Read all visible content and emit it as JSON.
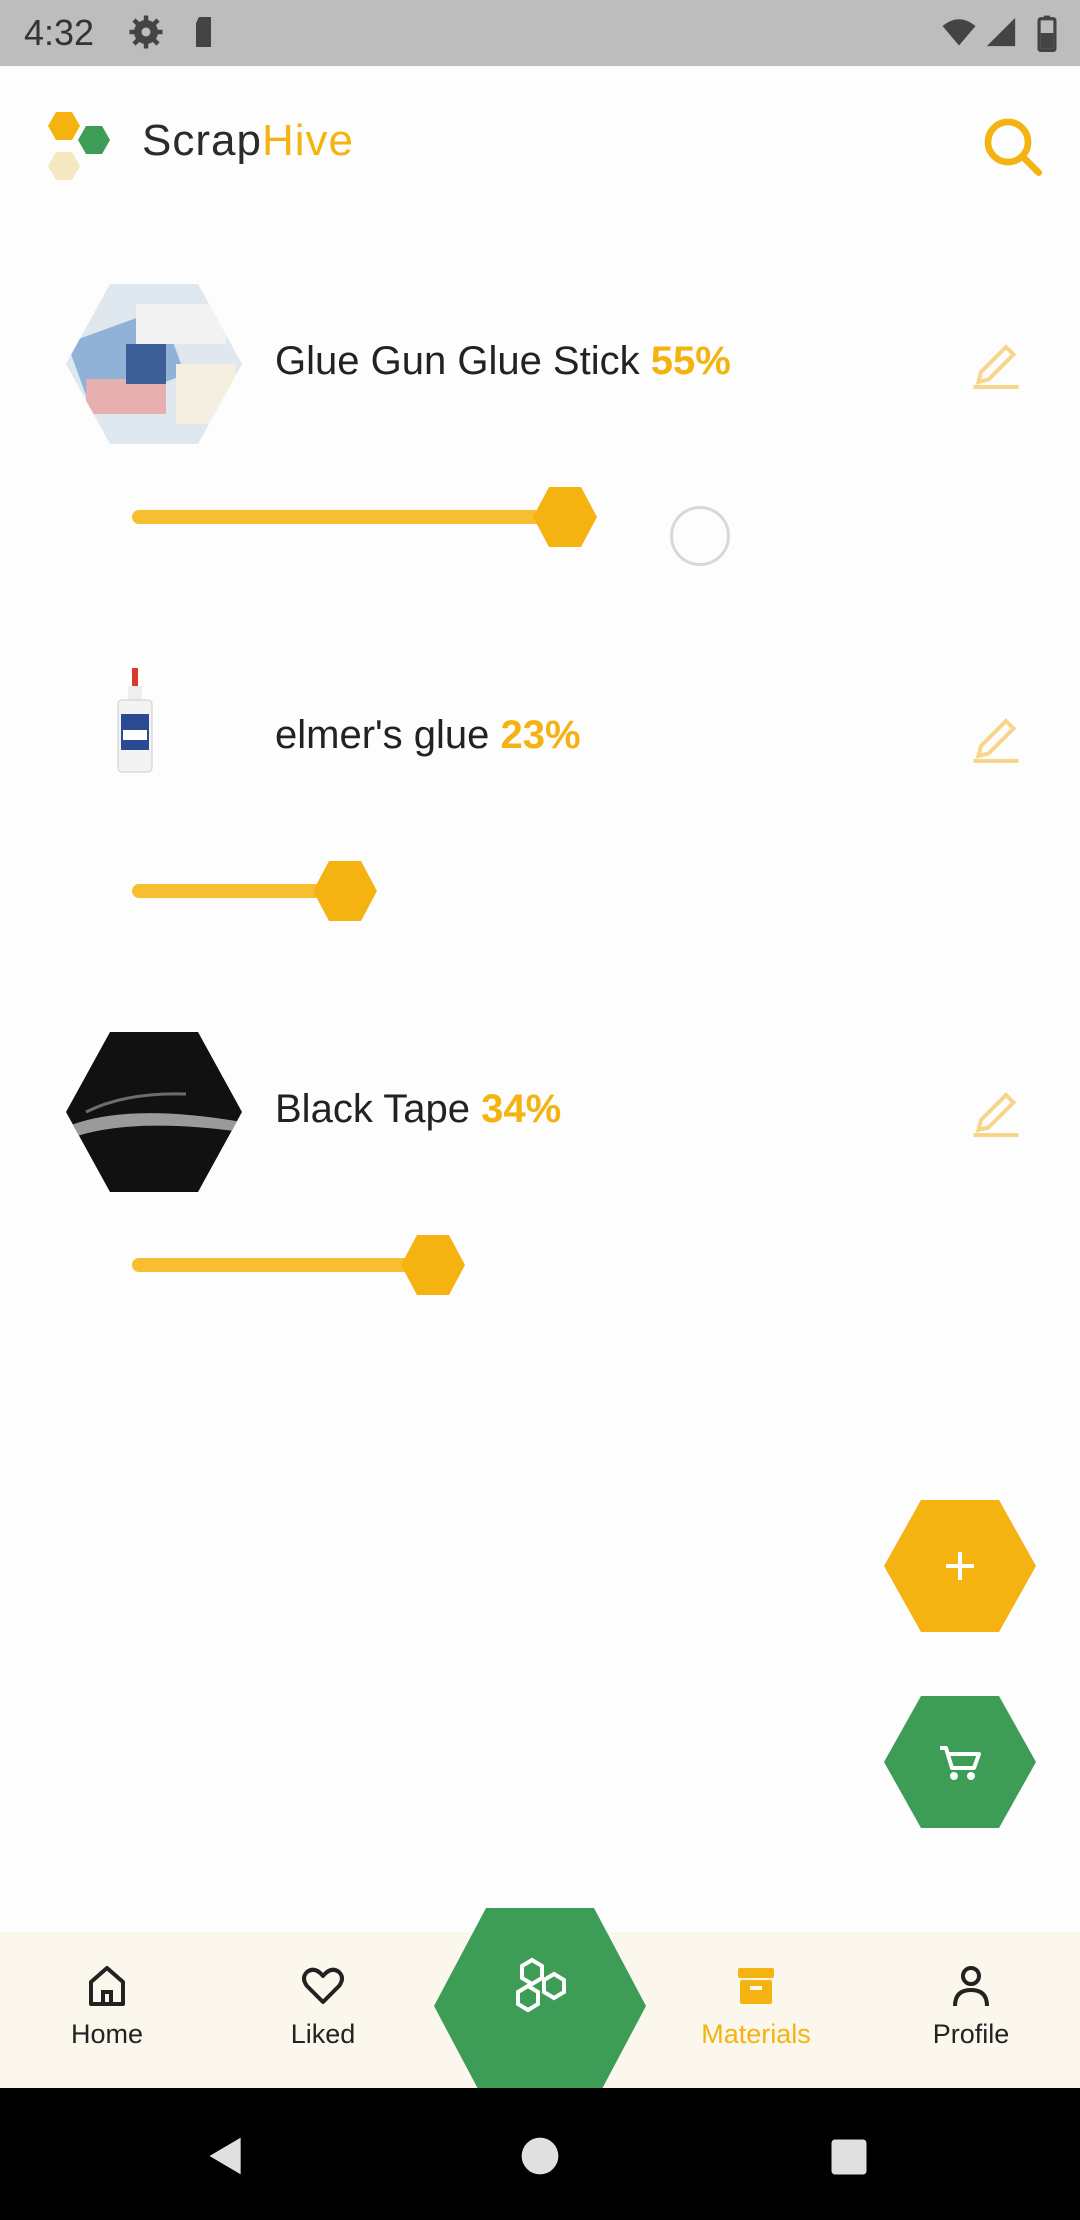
{
  "status_bar": {
    "time": "4:32"
  },
  "app": {
    "brand_part1": "Scrap",
    "brand_part2": "Hive"
  },
  "colors": {
    "accent": "#f5b312",
    "green": "#3d9d57",
    "text": "#222222"
  },
  "materials": [
    {
      "name": "Glue Gun Glue Stick",
      "percent": "55%",
      "level": 0.55
    },
    {
      "name": "elmer's glue",
      "percent": "23%",
      "level": 0.23
    },
    {
      "name": "Black Tape",
      "percent": "34%",
      "level": 0.34
    }
  ],
  "bottom_nav": [
    {
      "label": "Home",
      "icon": "home-icon"
    },
    {
      "label": "Liked",
      "icon": "heart-icon"
    },
    {
      "label": "Materials",
      "icon": "box-icon",
      "active": true
    },
    {
      "label": "Profile",
      "icon": "person-icon"
    }
  ],
  "icons": [
    "settings-icon",
    "wifi-icon",
    "signal-icon",
    "battery-icon",
    "search-icon",
    "edit-icon",
    "plus-icon",
    "cart-icon",
    "hive-icon",
    "back-icon",
    "home-circle-icon",
    "recents-icon"
  ]
}
